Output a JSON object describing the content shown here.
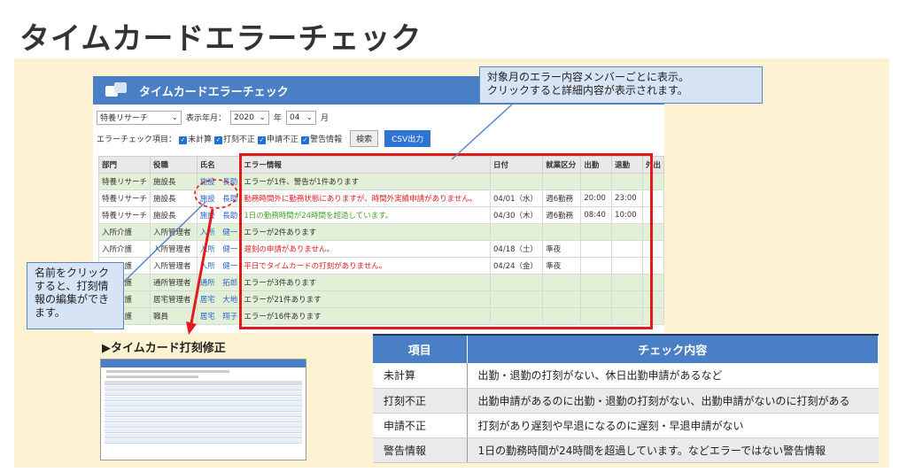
{
  "page_title": "タイムカードエラーチェック",
  "app": {
    "title": "タイムカードエラーチェック",
    "dept_select": "特養リサーチ",
    "month_label": "表示年月：",
    "year": "2020",
    "year_suffix": "年",
    "month": "04",
    "month_suffix": "月",
    "error_items_label": "エラーチェック項目：",
    "checks": [
      "未計算",
      "打刻不正",
      "申請不正",
      "警告情報"
    ],
    "search_label": "検索",
    "csv_label": "CSV出力",
    "columns": [
      "部門",
      "役職",
      "氏名",
      "エラー情報",
      "日付",
      "就業区分",
      "出勤",
      "退勤",
      "外出"
    ],
    "rows": [
      {
        "dept": "特養リサーチ",
        "role": "施設長",
        "name": "施設　長助",
        "error": "エラーが1件、警告が1件あります",
        "date": "",
        "kubun": "",
        "in": "",
        "out": "",
        "style": "g",
        "err_color": ""
      },
      {
        "dept": "特養リサーチ",
        "role": "施設長",
        "name": "施設　長助",
        "error": "勤務時間外に勤務状態にありますが、時間外実績申請がありません。",
        "date": "04/01（水）",
        "kubun": "週6勤務",
        "in": "20:00",
        "out": "23:00",
        "style": "w",
        "err_color": "red"
      },
      {
        "dept": "特養リサーチ",
        "role": "施設長",
        "name": "施設　長助",
        "error": "1日の勤務時間が24時間を超過しています。",
        "date": "04/30（木）",
        "kubun": "週6勤務",
        "in": "08:40",
        "out": "10:00",
        "style": "w",
        "err_color": "grn"
      },
      {
        "dept": "入所介護",
        "role": "入所管理者",
        "name": "入所　健一",
        "error": "エラーが2件あります",
        "date": "",
        "kubun": "",
        "in": "",
        "out": "",
        "style": "g",
        "err_color": ""
      },
      {
        "dept": "入所介護",
        "role": "入所管理者",
        "name": "入所　健一",
        "error": "遅刻の申請がありません。",
        "date": "04/18（土）",
        "kubun": "準夜",
        "in": "",
        "out": "",
        "style": "w",
        "err_color": "red"
      },
      {
        "dept": "入所介護",
        "role": "入所管理者",
        "name": "入所　健一",
        "error": "平日でタイムカードの打刻がありません。",
        "date": "04/24（金）",
        "kubun": "準夜",
        "in": "",
        "out": "",
        "style": "w",
        "err_color": "red"
      },
      {
        "dept": "通所介護",
        "role": "通所管理者",
        "name": "通所　拓郎",
        "error": "エラーが3件あります",
        "date": "",
        "kubun": "",
        "in": "",
        "out": "",
        "style": "g",
        "err_color": ""
      },
      {
        "dept": "居宅介護",
        "role": "居宅管理者",
        "name": "居宅　大地",
        "error": "エラーが21件あります",
        "date": "",
        "kubun": "",
        "in": "",
        "out": "",
        "style": "g",
        "err_color": ""
      },
      {
        "dept": "居宅介護",
        "role": "職員",
        "name": "居宅　翔子",
        "error": "エラーが16件あります",
        "date": "",
        "kubun": "",
        "in": "",
        "out": "",
        "style": "g",
        "err_color": ""
      }
    ]
  },
  "callout_top": "対象月のエラー内容メンバーごとに表示。\nクリックすると詳細内容が表示されます。",
  "callout_left": "名前をクリックすると、打刻情報の編集ができます。",
  "sub_title": "▶タイムカード打刻修正",
  "check_table": {
    "headers": [
      "項目",
      "チェック内容"
    ],
    "rows": [
      {
        "item": "未計算",
        "content": "出勤・退勤の打刻がない、休日出勤申請があるなど"
      },
      {
        "item": "打刻不正",
        "content": "出勤申請があるのに出勤・退勤の打刻がない、出勤申請がないのに打刻がある"
      },
      {
        "item": "申請不正",
        "content": "打刻があり遅刻や早退になるのに遅刻・早退申請がない"
      },
      {
        "item": "警告情報",
        "content": "1日の勤務時間が24時間を超過しています。などエラーではない警告情報"
      }
    ]
  },
  "colors": {
    "accent": "#4a7ec5",
    "highlight": "#e11b1b",
    "panel": "#fdf3d2"
  }
}
